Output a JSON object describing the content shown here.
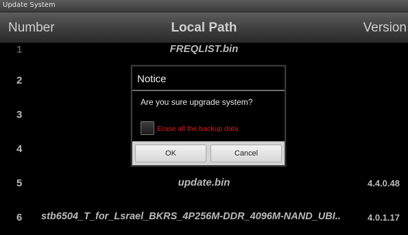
{
  "window": {
    "title": "Update System"
  },
  "table": {
    "headers": {
      "number": "Number",
      "path": "Local Path",
      "version": "Version"
    },
    "rows": [
      {
        "number": "1",
        "path": "FREQLIST.bin",
        "version": ""
      },
      {
        "number": "2",
        "path": "",
        "version": ""
      },
      {
        "number": "3",
        "path": "",
        "version": ""
      },
      {
        "number": "4",
        "path": "",
        "version": ""
      },
      {
        "number": "5",
        "path": "update.bin",
        "version": "4.4.0.48"
      },
      {
        "number": "6",
        "path": "stb6504_T_for_Lsrael_BKRS_4P256M-DDR_4096M-NAND_UBI..",
        "version": "4.0.1.17"
      }
    ]
  },
  "dialog": {
    "title": "Notice",
    "message": "Are you sure upgrade system?",
    "checkbox_label": "Erase all the backup data",
    "checkbox_checked": false,
    "ok_label": "OK",
    "cancel_label": "Cancel"
  },
  "colors": {
    "background": "#000000",
    "header_top": "#5c5c5c",
    "warning_text": "#e01a1a"
  }
}
